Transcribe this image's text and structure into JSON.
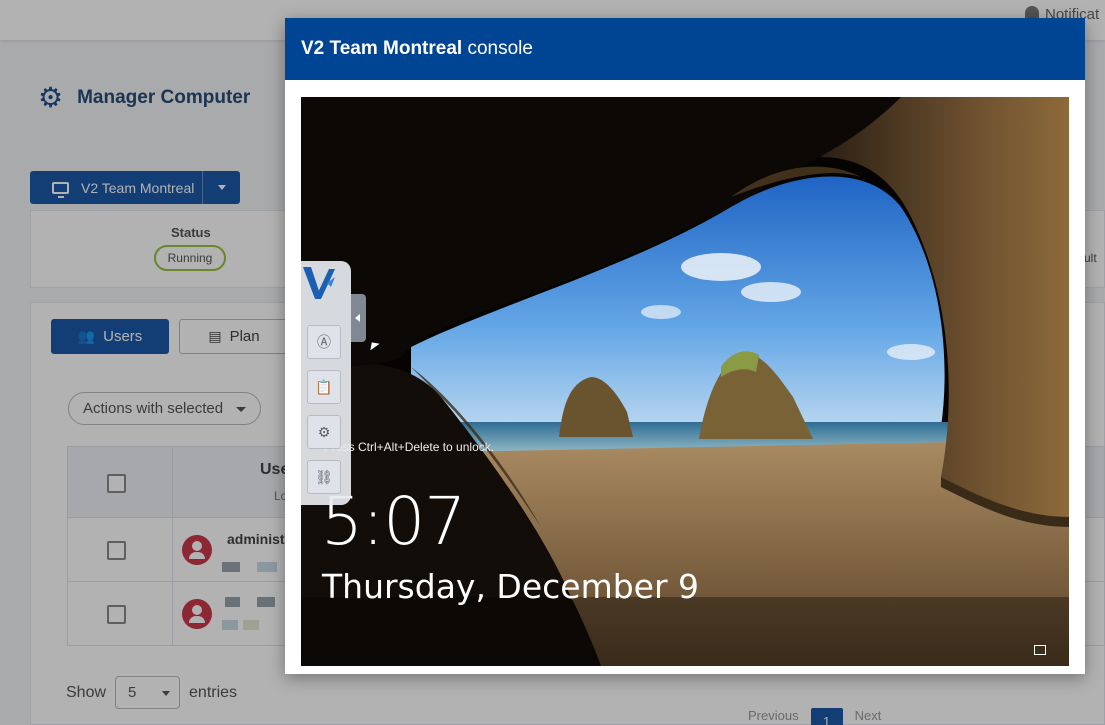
{
  "topbar": {
    "notifications_label": "Notificat"
  },
  "page": {
    "title": "Manager Computer"
  },
  "vm_selector": {
    "label": "V2 Team Montreal"
  },
  "status": {
    "label": "Status",
    "value": "Running",
    "right_cut_text": "ult"
  },
  "tabs": [
    {
      "label": "Users"
    },
    {
      "label": "Plan"
    }
  ],
  "actions_dropdown": {
    "label": "Actions with selected"
  },
  "table": {
    "header_user": "Use",
    "header_sub": "Lo",
    "rows": [
      {
        "username": "administ"
      },
      {
        "username": ""
      }
    ]
  },
  "pagination": {
    "show_label": "Show",
    "entries_value": "5",
    "entries_label": "entries",
    "previous": "Previous",
    "current_page": "1",
    "next": "Next"
  },
  "modal": {
    "title_bold": "V2 Team Montreal",
    "title_rest": " console",
    "lock_hint": "Press Ctrl+Alt+Delete to unlock.",
    "clock": "5:07",
    "date": "Thursday, December 9"
  },
  "toolbar": {
    "icons": [
      "vmware-logo-icon",
      "keyboard-icon",
      "clipboard-icon",
      "settings-icon",
      "disconnect-icon"
    ]
  },
  "colors": {
    "header_blue": "#004494",
    "primary_button": "#1c5aa8",
    "running_badge": "#9ac03d",
    "avatar": "#c9394a"
  }
}
